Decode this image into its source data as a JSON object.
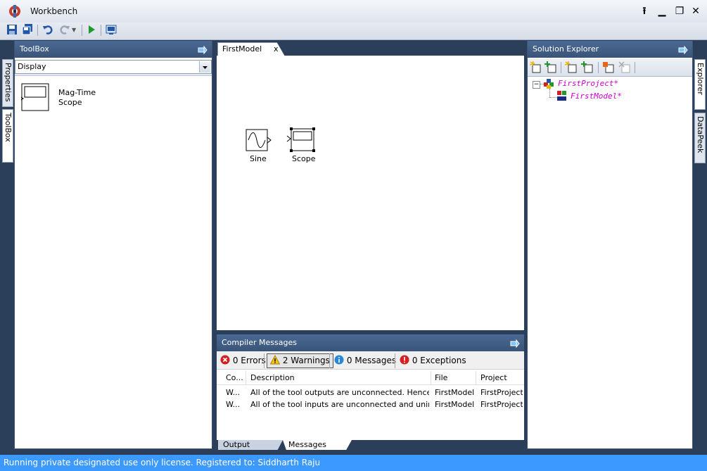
{
  "window": {
    "title": "Workbench"
  },
  "toolbox": {
    "title": "ToolBox",
    "category": "Display",
    "items": [
      {
        "label_line1": "Mag-Time",
        "label_line2": "Scope"
      }
    ]
  },
  "left_tabs": {
    "properties": "Properties",
    "toolbox": "ToolBox"
  },
  "editor": {
    "tab_label": "FirstModel",
    "tab_close": "x",
    "blocks": {
      "sine": "Sine",
      "scope": "Scope"
    }
  },
  "solution_explorer": {
    "title": "Solution Explorer",
    "project": "FirstProject*",
    "model": "FirstModel*"
  },
  "right_tabs": {
    "explorer": "Explorer",
    "datapeek": "DataPeek"
  },
  "compiler": {
    "title": "Compiler Messages",
    "filters": {
      "errors": "0 Errors",
      "warnings": "2 Warnings",
      "messages": "0 Messages",
      "exceptions": "0 Exceptions"
    },
    "columns": [
      "Co...",
      "Description",
      "File",
      "Project"
    ],
    "rows": [
      [
        "W...",
        "All of the tool outputs are unconnected. Hence mig...",
        "FirstModel",
        "FirstProject"
      ],
      [
        "W...",
        "All of the tool inputs are unconnected and unintializ...",
        "FirstModel",
        "FirstProject"
      ]
    ],
    "bottom_tabs": {
      "output": "Output",
      "messages": "Messages"
    }
  },
  "status": {
    "text": "Running private designated use only license. Registered to: Siddharth Raju"
  },
  "colors": {
    "panel_header": "#3a5478",
    "status_bar": "#3b99ff",
    "accent_magenta": "#cc00cc"
  }
}
